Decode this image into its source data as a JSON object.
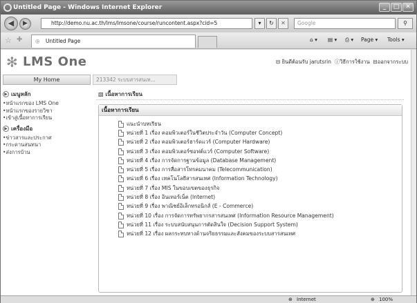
{
  "window": {
    "title": "Untitled Page - Windows Internet Explorer",
    "minimize": "_",
    "maximize": "□",
    "close": "✕"
  },
  "addressbar": {
    "back": "◀",
    "forward": "▶",
    "url": "http://demo.nu.ac.th/lms/lmsone/course/runcontent.aspx?cid=5",
    "search_placeholder": "Google",
    "search_go": "🔍"
  },
  "favorites": {
    "tab_title": "Untitled Page",
    "commands": [
      "Page ▾",
      "Tools ▾"
    ]
  },
  "site": {
    "logo": "LMS One",
    "welcome": "ยินดีต้อนรับ jarutsrin",
    "howto": "วิธีการใช้งาน",
    "logout": "ออกจากระบบ",
    "home_tab": "My Home",
    "breadcrumb": "213342 ระบบสารสนเท..."
  },
  "leftnav": {
    "main_title": "เมนูหลัก",
    "main_items": [
      "•หน้าแรกของ LMS One",
      "•หน้าแรกของรายวิชา",
      "•เข้าสู่เนื้อหาการเรียน"
    ],
    "tools_title": "เครื่องมือ",
    "tools_items": [
      "•ข่าวสารและประกาศ",
      "•กระดานสนทนา",
      "•ส่งการบ้าน"
    ]
  },
  "content": {
    "title": "เนื้อหาการเรียน",
    "panel_title": "เนื้อหาการเรียน",
    "items": [
      "แนะนำบทเรียน",
      "หน่วยที่ 1 เรื่อง คอมพิวเตอร์ในชีวิตประจำวัน (Computer Concept)",
      "หน่วยที่ 2 เรื่อง คอมพิวเตอร์ฮาร์ดแวร์ (Computer Hardware)",
      "หน่วยที่ 3 เรื่อง คอมพิวเตอร์ซอฟต์แวร์ (Computer Software)",
      "หน่วยที่ 4 เรื่อง การจัดการฐานข้อมูล (Database Management)",
      "หน่วยที่ 5 เรื่อง การสื่อสารโทรคมนาคม (Telecommunication)",
      "หน่วยที่ 6 เรื่อง เทคโนโลยีสารสนเทศ (Information Technology)",
      "หน่วยที่ 7 เรื่อง MIS ในขอบเขตของธุรกิจ",
      "หน่วยที่ 8 เรื่อง อินเทอร์เน็ต (Internet)",
      "หน่วยที่ 9 เรื่อง พาณิชย์อิเล็กทรอนิกส์ (E - Commerce)",
      "หน่วยที่ 10 เรื่อง การจัดการทรัพยากรสารสนเทศ (Information Resource Management)",
      "หน่วยที่ 11 เรื่อง ระบบสนับสนุนการตัดสินใจ (Decision Support System)",
      "หน่วยที่ 12 เรื่อง ผลกระทบทางด้านจริยธรรมและสังคมของระบบสารสนเทศ"
    ]
  },
  "status": {
    "zone": "Internet",
    "zoom": "100%"
  }
}
